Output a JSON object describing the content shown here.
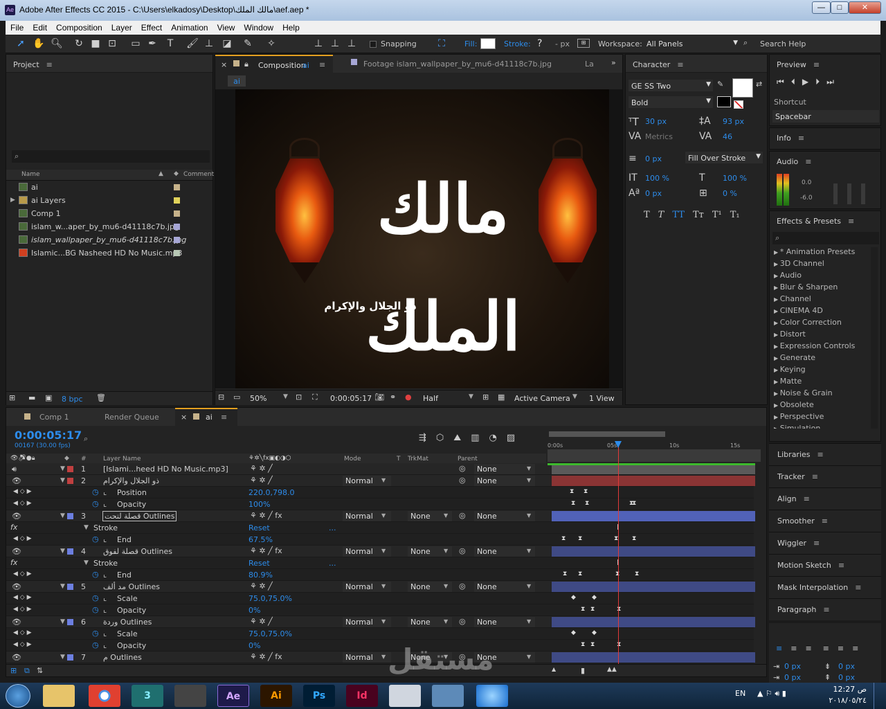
{
  "app": {
    "title": "Adobe After Effects CC 2015 - C:\\Users\\elkadosy\\Desktop\\مالك الملك\\aef.aep *",
    "icon": "Ae"
  },
  "window_controls": [
    "—",
    "□",
    "✕"
  ],
  "menu": [
    "File",
    "Edit",
    "Composition",
    "Layer",
    "Effect",
    "Animation",
    "View",
    "Window",
    "Help"
  ],
  "toolbar": {
    "snapping": "Snapping",
    "fill": "Fill:",
    "stroke": "Stroke:",
    "stroke_q": "?",
    "px": "- px",
    "workspace_label": "Workspace:",
    "workspace_value": "All Panels",
    "search": "Search Help"
  },
  "project": {
    "title": "Project",
    "col_name": "Name",
    "col_comment": "Comment",
    "bpc": "8 bpc",
    "items": [
      {
        "name": "ai",
        "color": "#c6b28a",
        "italic": false
      },
      {
        "name": "ai Layers",
        "color": "#e0d25a",
        "italic": false
      },
      {
        "name": "Comp 1",
        "color": "#c6b28a",
        "italic": false
      },
      {
        "name": "islam_w...aper_by_mu6-d41118c7b.jpg",
        "color": "#a7a7d6",
        "italic": false
      },
      {
        "name": "islam_wallpaper_by_mu6-d41118c7b.jpg",
        "color": "#a7a7d6",
        "italic": true
      },
      {
        "name": "Islamic...BG  Nasheed HD No Music.mp3",
        "color": "#b7c7b4",
        "italic": false
      }
    ]
  },
  "viewer": {
    "tab_comp": "Composition",
    "tab_comp_name": "ai",
    "tab_footage": "Footage  islam_wallpaper_by_mu6-d41118c7b.jpg",
    "tab_layer": "La",
    "crumb": "ai",
    "calligraphy_main": "مالك الملك",
    "calligraphy_sub": "ذو الجلال والإكرام",
    "zoom": "50%",
    "timecode": "0:00:05:17",
    "resolution": "Half",
    "camera": "Active Camera",
    "views": "1 View"
  },
  "character": {
    "title": "Character",
    "font": "GE SS Two",
    "style": "Bold",
    "size": "30 px",
    "leading": "93 px",
    "kerning": "Metrics",
    "tracking": "46",
    "stroke_width": "0 px",
    "stroke_mode": "Fill Over Stroke",
    "vscale": "100 %",
    "hscale": "100 %",
    "baseline": "0 px",
    "tsume": "0 %",
    "styles": [
      "T",
      "T",
      "TT",
      "Tт",
      "T¹",
      "T₁"
    ]
  },
  "preview": {
    "title": "Preview",
    "shortcut_label": "Shortcut",
    "shortcut": "Spacebar"
  },
  "info": {
    "title": "Info"
  },
  "audio": {
    "title": "Audio",
    "db1": "0.0",
    "db2": "-6.0"
  },
  "effects": {
    "title": "Effects & Presets",
    "items": [
      "* Animation Presets",
      "3D Channel",
      "Audio",
      "Blur & Sharpen",
      "Channel",
      "CINEMA 4D",
      "Color Correction",
      "Distort",
      "Expression Controls",
      "Generate",
      "Keying",
      "Matte",
      "Noise & Grain",
      "Obsolete",
      "Perspective",
      "Simulation"
    ]
  },
  "right_panels": [
    "Libraries",
    "Tracker",
    "Align",
    "Smoother",
    "Wiggler",
    "Motion Sketch",
    "Mask Interpolation",
    "Paragraph"
  ],
  "paragraph": {
    "indent1": "0 px",
    "indent2": "0 px",
    "indent3": "0 px",
    "indent4": "0 px"
  },
  "timeline": {
    "tabs": [
      "Comp 1",
      "Render Queue",
      "ai"
    ],
    "timecode": "0:00:05:17",
    "frames": "00167 (30.00 fps)",
    "headers": {
      "num": "#",
      "layer": "Layer Name",
      "mode": "Mode",
      "t": "T",
      "trkmat": "TrkMat",
      "parent": "Parent"
    },
    "ruler": [
      "0:00s",
      "05s",
      "10s",
      "15s"
    ],
    "rows": [
      {
        "type": "layer",
        "num": "1",
        "name": "[Islami...heed HD No Music.mp3]",
        "color": "#c04040",
        "mode": "",
        "trk": "",
        "parent": "None",
        "bar": "#5a5a5a"
      },
      {
        "type": "layer",
        "num": "2",
        "name": "ذو الجلال والإكرام",
        "color": "#c04040",
        "mode": "Normal",
        "trk": "",
        "parent": "None",
        "bar": "#8a3434"
      },
      {
        "type": "prop",
        "name": "Position",
        "value": "220.0,798.0"
      },
      {
        "type": "prop",
        "name": "Opacity",
        "value": "100%"
      },
      {
        "type": "layer",
        "num": "3",
        "name": "قصلة لتحت Outlines",
        "color": "#6c7fe0",
        "mode": "Normal",
        "trk": "None",
        "parent": "None",
        "bar": "#5162b8"
      },
      {
        "type": "group",
        "name": "Stroke",
        "value": "Reset"
      },
      {
        "type": "prop",
        "name": "End",
        "value": "67.5%"
      },
      {
        "type": "layer",
        "num": "4",
        "name": "قصلة لفوق Outlines",
        "color": "#6c7fe0",
        "mode": "Normal",
        "trk": "None",
        "parent": "None",
        "bar": "#3f4a85"
      },
      {
        "type": "group",
        "name": "Stroke",
        "value": "Reset"
      },
      {
        "type": "prop",
        "name": "End",
        "value": "80.9%"
      },
      {
        "type": "layer",
        "num": "5",
        "name": "مد ألف Outlines",
        "color": "#6c7fe0",
        "mode": "Normal",
        "trk": "None",
        "parent": "None",
        "bar": "#3f4a85"
      },
      {
        "type": "prop",
        "name": "Scale",
        "value": "75.0,75.0%"
      },
      {
        "type": "prop",
        "name": "Opacity",
        "value": "0%"
      },
      {
        "type": "layer",
        "num": "6",
        "name": "وردة Outlines",
        "color": "#6c7fe0",
        "mode": "Normal",
        "trk": "None",
        "parent": "None",
        "bar": "#3f4a85"
      },
      {
        "type": "prop",
        "name": "Scale",
        "value": "75.0,75.0%"
      },
      {
        "type": "prop",
        "name": "Opacity",
        "value": "0%"
      },
      {
        "type": "layer",
        "num": "7",
        "name": "م Outlines",
        "color": "#6c7fe0",
        "mode": "Normal",
        "trk": "None",
        "parent": "None",
        "bar": "#3f4a85"
      }
    ]
  },
  "watermark": "مستقل",
  "taskbar": {
    "apps": [
      "Ae",
      "Ai",
      "Ps",
      "Id"
    ],
    "lang": "EN",
    "time": "12:27 ص",
    "date": "٢٠١٨/٠٥/٢٤"
  }
}
